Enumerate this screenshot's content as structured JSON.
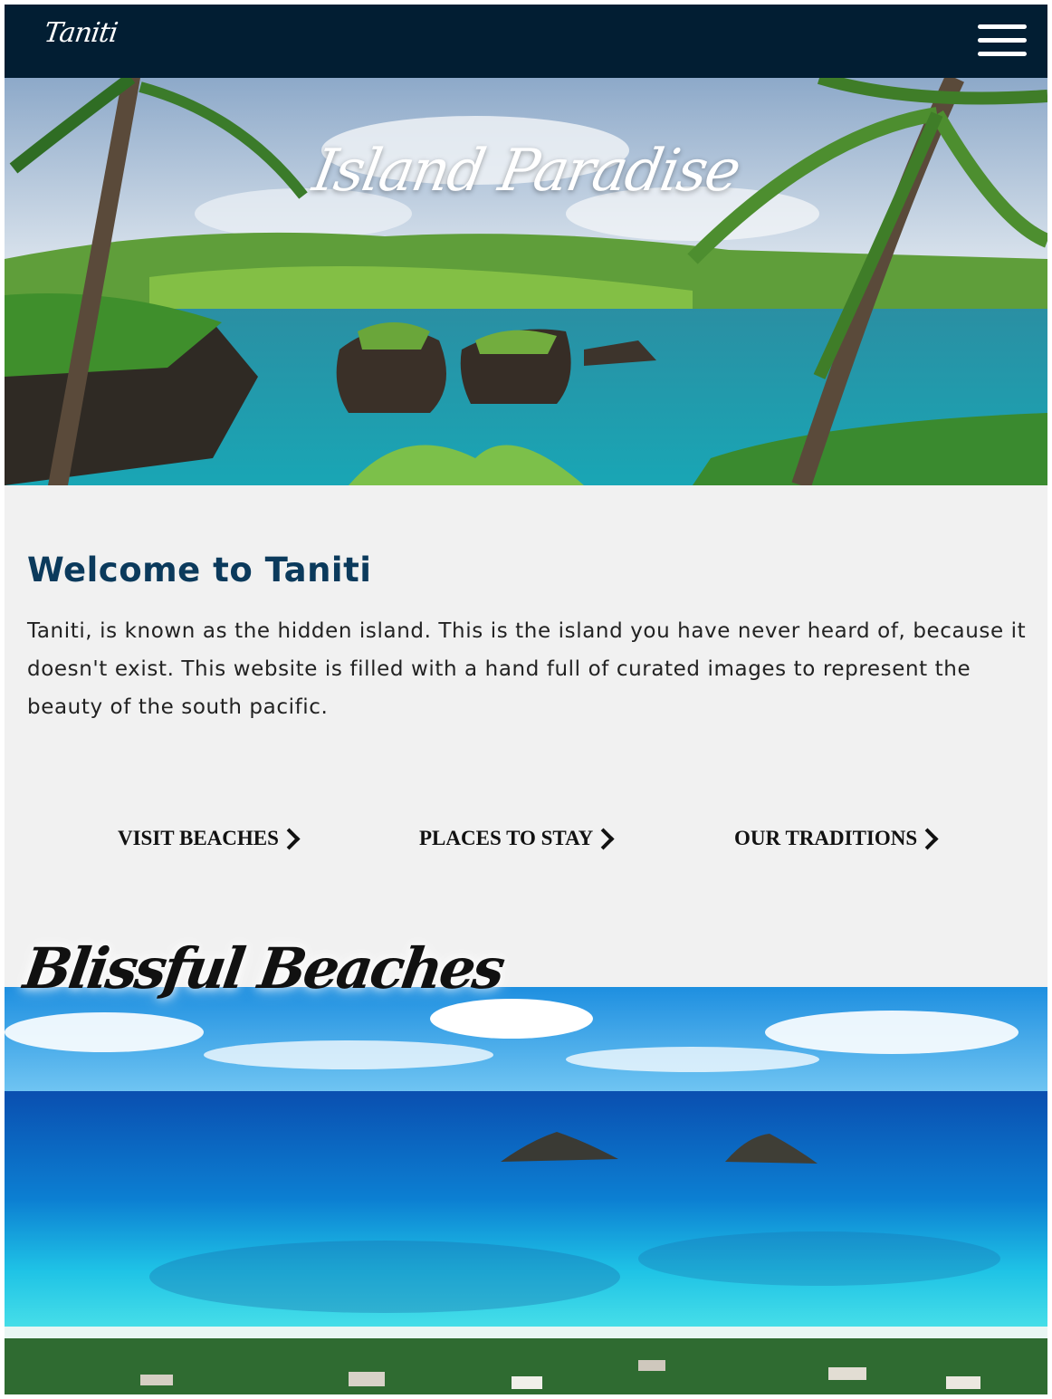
{
  "navbar": {
    "logo_text": "Taniti",
    "menu_icon": "hamburger-menu-icon"
  },
  "hero": {
    "title": "Island Paradise"
  },
  "welcome": {
    "heading": "Welcome to Taniti",
    "text": "Taniti, is known as the hidden island. This is the island you have never heard of, because it doesn't exist. This website is filled with a hand full of curated images to represent the beauty of the south pacific."
  },
  "links": [
    {
      "label": "VISIT BEACHES",
      "icon": "chevron-right-icon"
    },
    {
      "label": "PLACES TO STAY",
      "icon": "chevron-right-icon"
    },
    {
      "label": "OUR TRADITIONS",
      "icon": "chevron-right-icon"
    }
  ],
  "beaches": {
    "title": "Blissful Beaches"
  },
  "colors": {
    "navbar_bg": "#021e33",
    "heading": "#0b3a5c",
    "page_bg": "#f1f1f1"
  }
}
